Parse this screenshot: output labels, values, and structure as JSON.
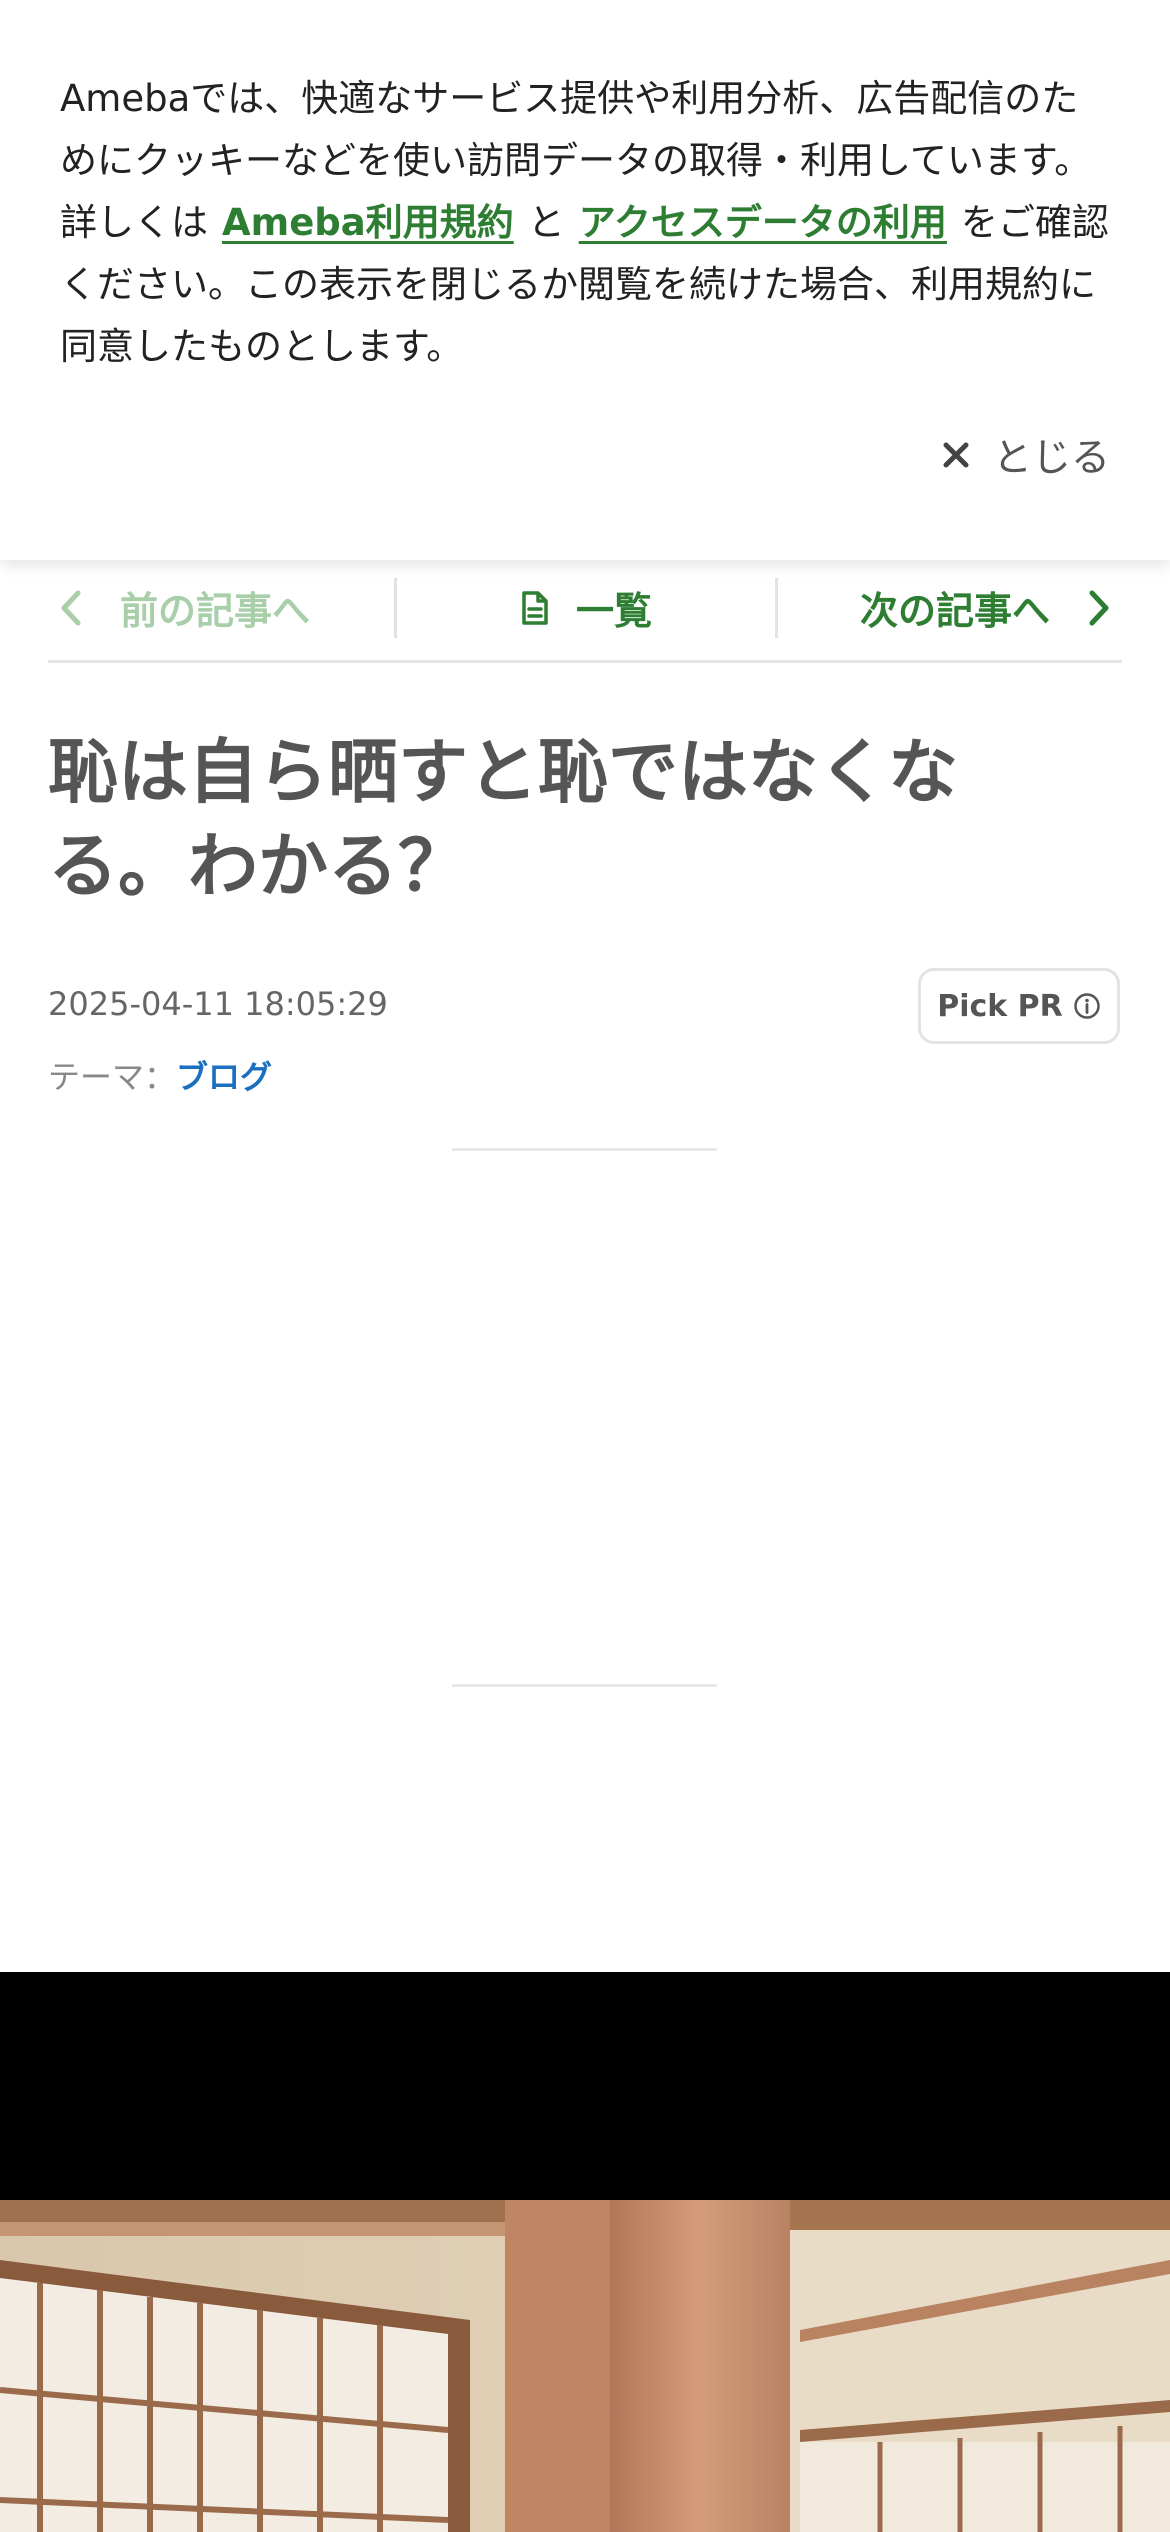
{
  "cookie_banner": {
    "text_before": "Amebaでは、快適なサービス提供や利用分析、広告配信のためにクッキーなどを使い訪問データの取得・利用しています。詳しくは",
    "link_terms": "Ameba利用規約",
    "text_and": "と",
    "link_access": "アクセスデータの利用",
    "text_after": "をご確認ください。この表示を閉じるか閲覧を続けた場合、利用規約に同意したものとします。",
    "close_label": "とじる"
  },
  "article_nav": {
    "prev_label": "前の記事へ",
    "list_label": "一覧",
    "next_label": "次の記事へ"
  },
  "article": {
    "title": "恥は自ら晒すと恥ではなくなる。わかる？",
    "datetime": "2025-04-11 18:05:29",
    "theme_prefix": "テーマ：",
    "theme_name": "ブログ",
    "pickpr_label": "Pick PR"
  },
  "colors": {
    "accent_green": "#2d7d32",
    "theme_link_blue": "#1a6fbf"
  }
}
